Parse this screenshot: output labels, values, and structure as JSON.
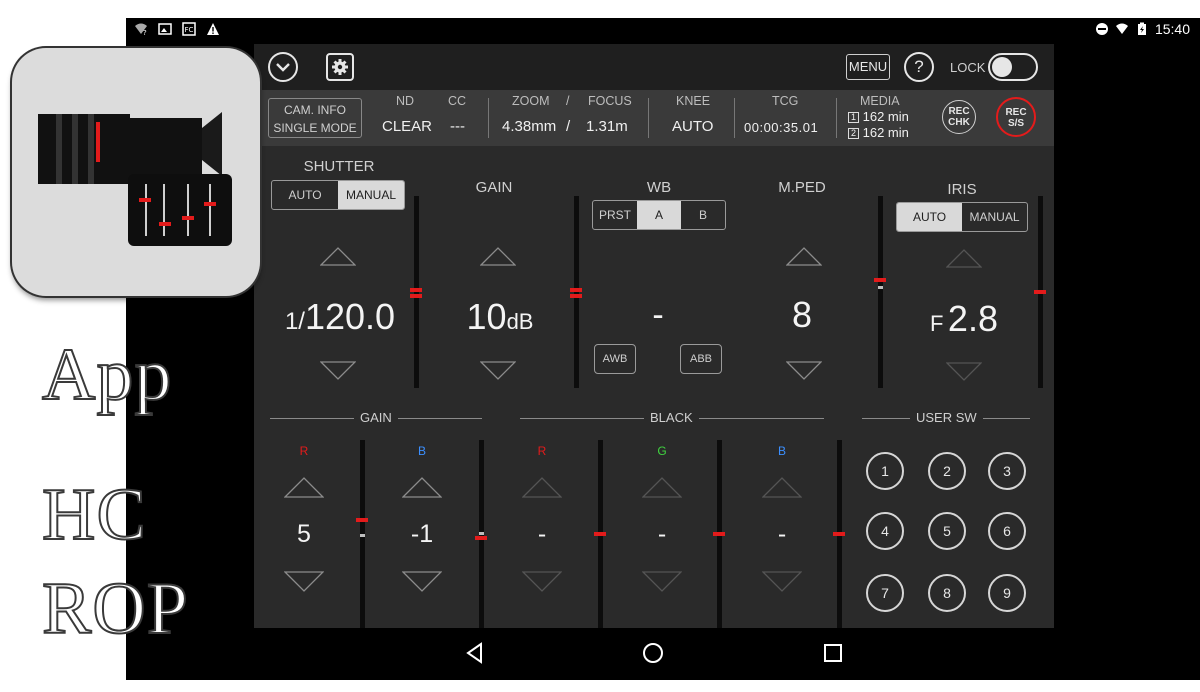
{
  "status_bar": {
    "time": "15:40"
  },
  "top_bar": {
    "menu_label": "MENU",
    "help_label": "?",
    "lock_label": "LOCK"
  },
  "info_bar": {
    "cam_info_line1": "CAM. INFO",
    "cam_info_line2": "SINGLE MODE",
    "nd_label": "ND",
    "nd_value": "CLEAR",
    "cc_label": "CC",
    "cc_value": "---",
    "zoom_label": "ZOOM",
    "zoom_value": "4.38mm",
    "slash": "/",
    "focus_label": "FOCUS",
    "focus_value": "1.31m",
    "knee_label": "KNEE",
    "knee_value": "AUTO",
    "tcg_label": "TCG",
    "tcg_value": "00:00:35.01",
    "media_label": "MEDIA",
    "media_slot1": "1",
    "media_slot1_value": "162 min",
    "media_slot2": "2",
    "media_slot2_value": "162 min",
    "rec_chk_line1": "REC",
    "rec_chk_line2": "CHK",
    "rec_ss_line1": "REC",
    "rec_ss_line2": "S/S"
  },
  "shutter": {
    "title": "SHUTTER",
    "auto_label": "AUTO",
    "manual_label": "MANUAL",
    "mode": "MANUAL",
    "prefix": "1/",
    "value": "120.0"
  },
  "gain": {
    "title": "GAIN",
    "value": "10",
    "unit": "dB"
  },
  "wb": {
    "title": "WB",
    "prst_label": "PRST",
    "a_label": "A",
    "b_label": "B",
    "mode": "A",
    "value": "-",
    "awb_label": "AWB",
    "abb_label": "ABB"
  },
  "mped": {
    "title": "M.PED",
    "value": "8"
  },
  "iris": {
    "title": "IRIS",
    "auto_label": "AUTO",
    "manual_label": "MANUAL",
    "mode": "AUTO",
    "prefix": "F",
    "value": "2.8"
  },
  "gain_group": {
    "title": "GAIN",
    "r_label": "R",
    "r_value": "5",
    "b_label": "B",
    "b_value": "-1"
  },
  "black_group": {
    "title": "BLACK",
    "r_label": "R",
    "r_value": "-",
    "g_label": "G",
    "g_value": "-",
    "b_label": "B",
    "b_value": "-"
  },
  "user_sw": {
    "title": "USER SW",
    "buttons": [
      "1",
      "2",
      "3",
      "4",
      "5",
      "6",
      "7",
      "8",
      "9"
    ]
  },
  "overlay": {
    "line1": "App",
    "line2": "HC",
    "line3": "ROP"
  },
  "colors": {
    "red": "#e31b1b",
    "green": "#3fd23f",
    "blue": "#3b8fff",
    "panel": "#2a2a2a"
  }
}
